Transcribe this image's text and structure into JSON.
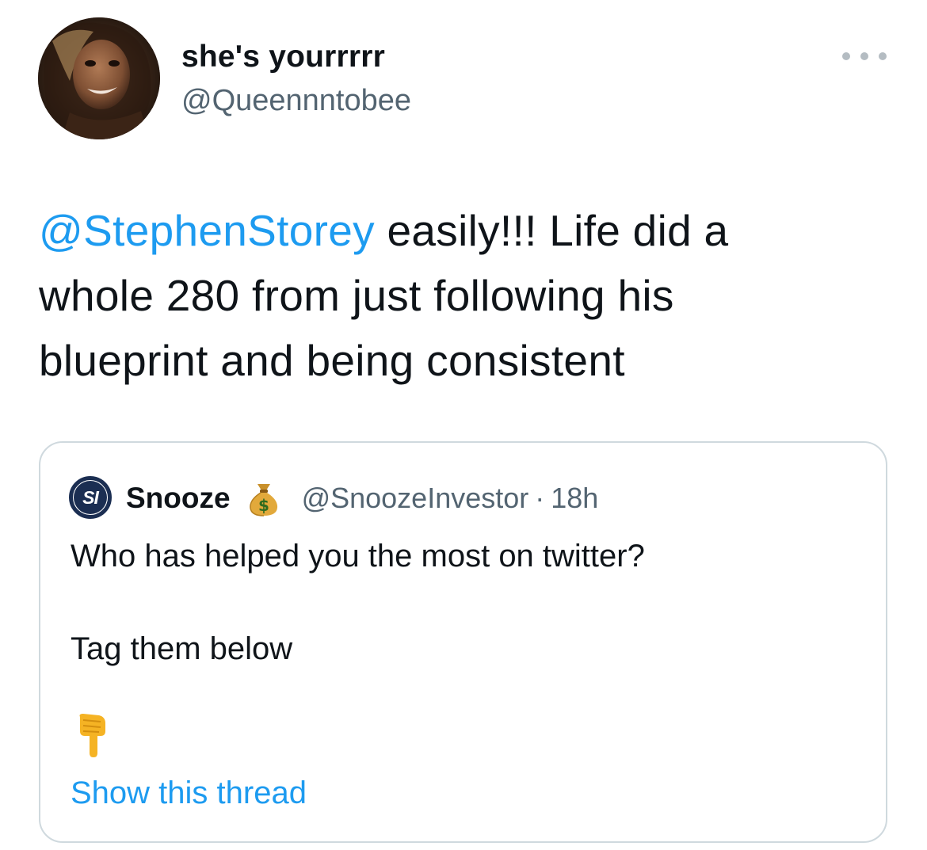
{
  "author": {
    "display_name": "she's yourrrrr",
    "handle": "@Queennntobee"
  },
  "tweet": {
    "mention": "@StephenStorey",
    "text_line1_rest": " easily!!! Life did a",
    "text_line2": "whole 280 from just following his",
    "text_line3": "blueprint and being consistent"
  },
  "more_button": {
    "icon": "more-horizontal-icon"
  },
  "quoted": {
    "logo_text": "SI",
    "display_name": "Snooze",
    "badge_icon": "money-bag-icon",
    "handle": "@SnoozeInvestor",
    "separator": "·",
    "time": "18h",
    "line1": "Who has helped you the most on twitter?",
    "line2": "Tag them below",
    "emoji_icon": "pointing-down-hand-icon",
    "show_thread": "Show this thread"
  },
  "colors": {
    "link": "#1d9bf0",
    "secondary_text": "#536471",
    "border": "#cfd9de",
    "text": "#0f1419"
  }
}
